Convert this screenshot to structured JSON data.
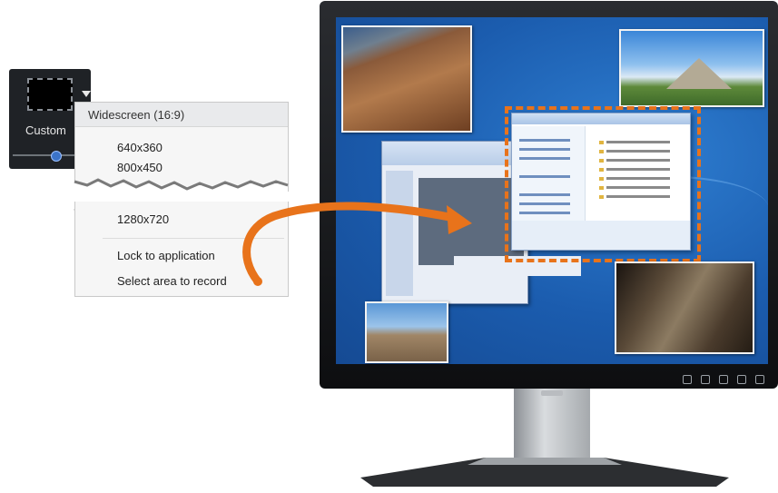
{
  "recorder": {
    "label": "Custom",
    "icon": "dashed-region-icon",
    "dropdown_icon": "caret-down-icon"
  },
  "menu": {
    "header": "Widescreen (16:9)",
    "items": [
      "640x360",
      "800x450",
      "1280x720"
    ],
    "lock_label": "Lock to application",
    "select_label": "Select area to record"
  },
  "colors": {
    "accent": "#e8731b",
    "desktop": "#1b5cae",
    "menu_bg": "#f6f6f6"
  }
}
